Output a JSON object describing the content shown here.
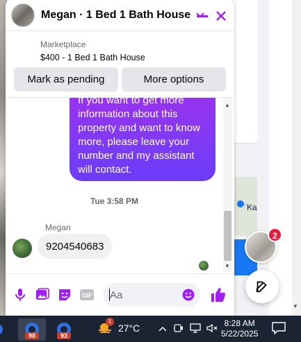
{
  "chat": {
    "title": "Megan · 1 Bed 1 Bath House",
    "listing_source": "Marketplace",
    "listing_title": "$400 - 1 Bed 1 Bath House",
    "actions": {
      "pending": "Mark as pending",
      "more": "More options"
    },
    "outgoing_lines": [
      "If you want to get more",
      "information about this",
      "property and want to know",
      "more, please leave your",
      "number and my assistant",
      "will contact."
    ],
    "timestamp": "Tue 3:58 PM",
    "sender_name": "Megan",
    "incoming_message": "9204540683",
    "composer_placeholder": "Aa",
    "accent_color": "#a020f0"
  },
  "background": {
    "map_label": "Ka",
    "chat_head_badge": "2"
  },
  "taskbar": {
    "app_badges": [
      "98",
      "93"
    ],
    "weather_badge": "1",
    "temperature": "27°C",
    "time": "8:28 AM",
    "date": "5/22/2025"
  }
}
